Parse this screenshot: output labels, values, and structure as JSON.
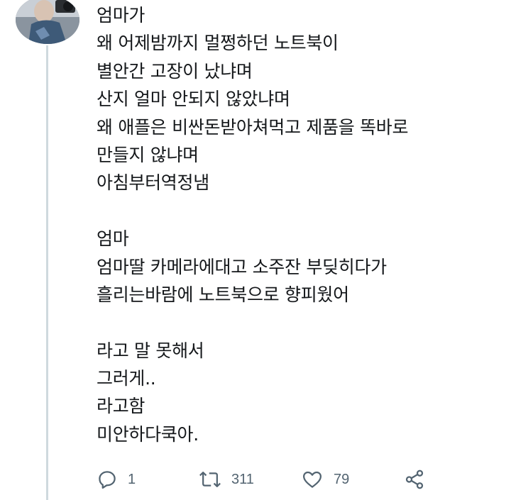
{
  "tweet": {
    "lines": [
      "엄마가",
      "왜 어제밤까지 멀쩡하던 노트북이",
      "별안간 고장이 났냐며",
      "산지 얼마 안되지 않았냐며",
      "왜 애플은 비싼돈받아쳐먹고 제품을 똑바로",
      "만들지 않냐며",
      "아침부터역정냄",
      "",
      "엄마",
      "엄마딸 카메라에대고 소주잔 부딪히다가",
      "흘리는바람에 노트북으로 향피웠어",
      "",
      "라고 말 못해서",
      "그러게..",
      "라고함",
      "미안하다쿡아."
    ]
  },
  "actions": {
    "reply": {
      "icon": "reply-icon",
      "count": "1"
    },
    "retweet": {
      "icon": "retweet-icon",
      "count": "311"
    },
    "like": {
      "icon": "heart-icon",
      "count": "79"
    },
    "share": {
      "icon": "share-icon"
    }
  },
  "colors": {
    "text": "#14171a",
    "icon": "#536471",
    "thread_line": "#cfd9de"
  }
}
